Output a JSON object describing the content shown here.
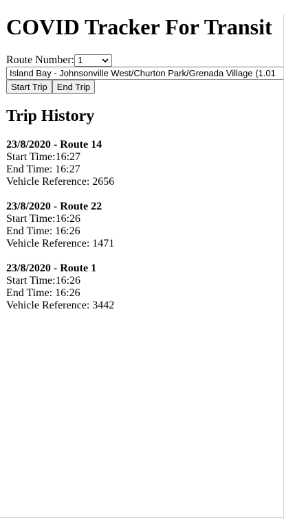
{
  "page": {
    "title": "COVID Tracker For Transit"
  },
  "form": {
    "route_label": "Route Number:",
    "route_selected": "1",
    "route_description": "Island Bay - Johnsonville West/Churton Park/Grenada Village (1.01",
    "start_button": "Start Trip",
    "end_button": "End Trip"
  },
  "history": {
    "heading": "Trip History",
    "start_label": "Start Time:",
    "end_label": "End Time: ",
    "vehicle_label": "Vehicle Reference: ",
    "trips": [
      {
        "title": "23/8/2020 - Route 14",
        "start": "16:27",
        "end": "16:27",
        "vehicle": "2656"
      },
      {
        "title": "23/8/2020 - Route 22",
        "start": "16:26",
        "end": "16:26",
        "vehicle": "1471"
      },
      {
        "title": "23/8/2020 - Route 1",
        "start": "16:26",
        "end": "16:26",
        "vehicle": "3442"
      }
    ]
  }
}
